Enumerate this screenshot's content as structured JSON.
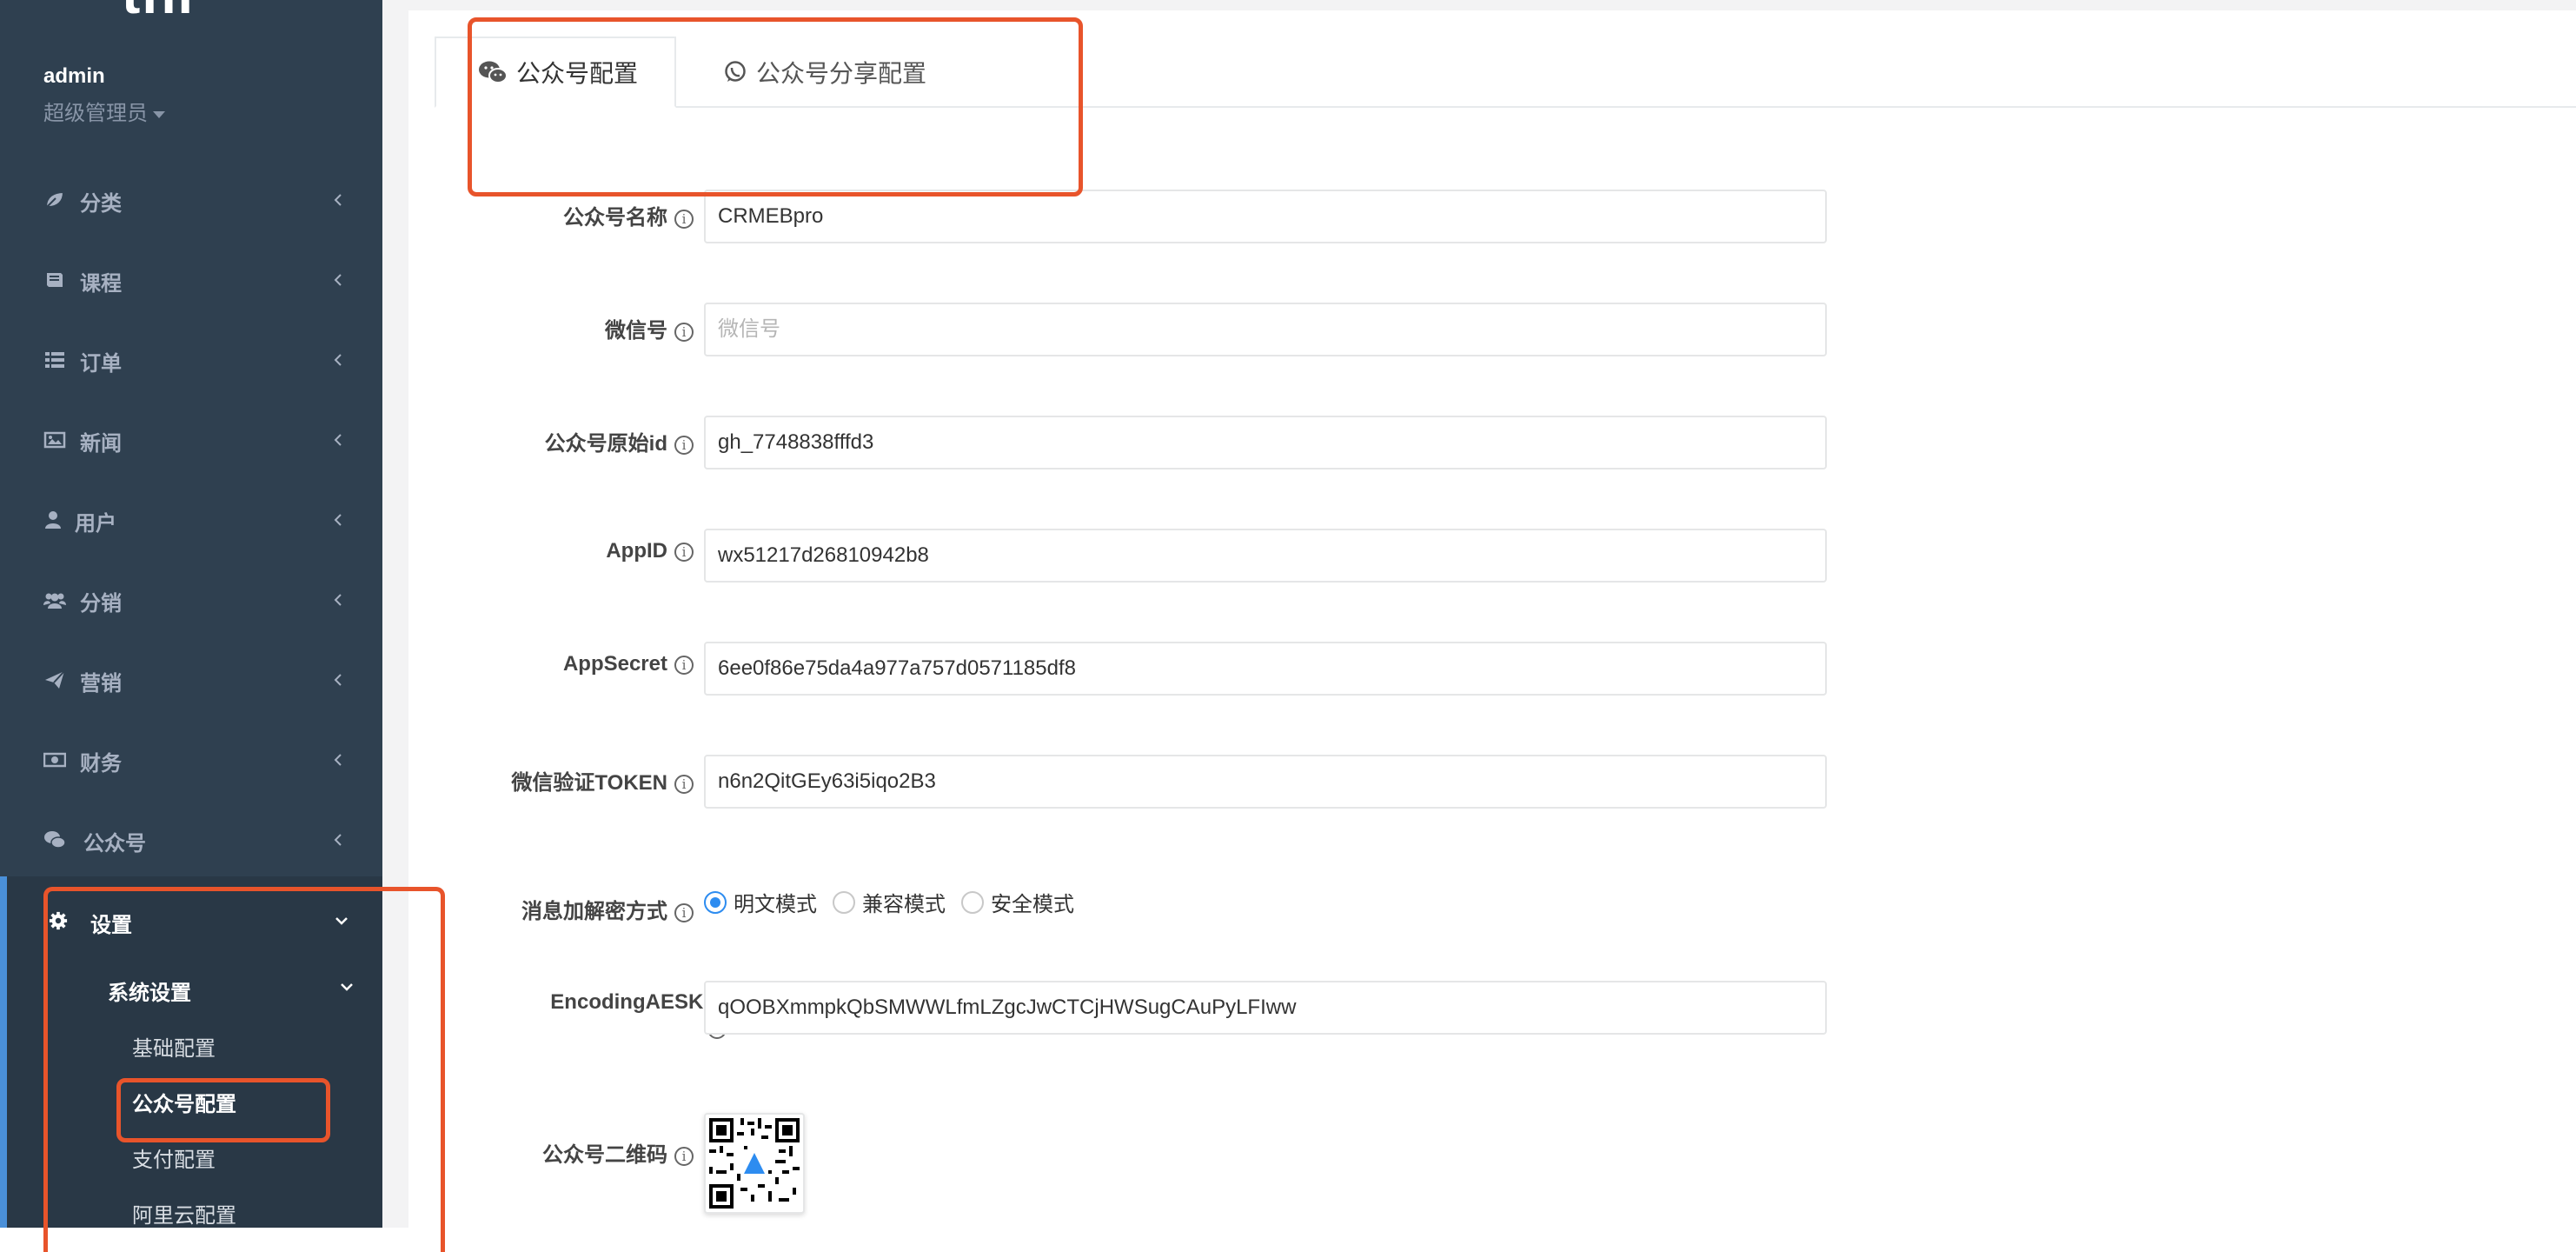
{
  "sidebar": {
    "logo_text": "thi",
    "user": {
      "name": "admin",
      "role": "超级管理员"
    },
    "items": [
      {
        "label": "分类",
        "icon": "leaf-icon"
      },
      {
        "label": "课程",
        "icon": "book-icon"
      },
      {
        "label": "订单",
        "icon": "list-icon"
      },
      {
        "label": "新闻",
        "icon": "image-icon"
      },
      {
        "label": "用户",
        "icon": "user-icon"
      },
      {
        "label": "分销",
        "icon": "users-icon"
      },
      {
        "label": "营销",
        "icon": "paper-plane-icon"
      },
      {
        "label": "财务",
        "icon": "money-icon"
      },
      {
        "label": "公众号",
        "icon": "wechat-icon"
      }
    ],
    "settings": {
      "label": "设置",
      "sub_group": "系统设置",
      "sub_items": [
        "基础配置",
        "公众号配置",
        "支付配置",
        "阿里云配置"
      ],
      "active_item": "公众号配置"
    }
  },
  "tabs": [
    {
      "label": "公众号配置",
      "icon": "wechat-icon",
      "active": true
    },
    {
      "label": "公众号分享配置",
      "icon": "whatsapp-icon",
      "active": false
    }
  ],
  "form": {
    "name": {
      "label": "公众号名称",
      "value": "CRMEBpro"
    },
    "wechat_id": {
      "label": "微信号",
      "value": "",
      "placeholder": "微信号"
    },
    "original_id": {
      "label": "公众号原始id",
      "value": "gh_7748838fffd3"
    },
    "appid": {
      "label": "AppID",
      "value": "wx51217d26810942b8"
    },
    "appsecret": {
      "label": "AppSecret",
      "value": "6ee0f86e75da4a977a757d0571185df8"
    },
    "token": {
      "label": "微信验证TOKEN",
      "value": "n6n2QitGEy63i5iqo2B3"
    },
    "encrypt_mode": {
      "label": "消息加解密方式",
      "options": [
        "明文模式",
        "兼容模式",
        "安全模式"
      ],
      "selected": "明文模式"
    },
    "aes_key": {
      "label": "EncodingAESKey",
      "value": "qOOBXmmpkQbSMWWLfmLZgcJwCTCjHWSugCAuPyLFIww"
    },
    "qrcode": {
      "label": "公众号二维码"
    }
  },
  "info_glyph": "i",
  "colors": {
    "sidebar_bg": "#2f4050",
    "accent_blue": "#2d8cf0",
    "annotation": "#e8542b"
  }
}
